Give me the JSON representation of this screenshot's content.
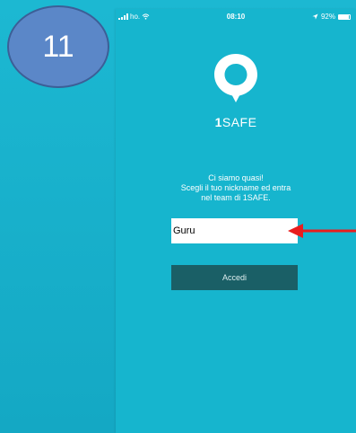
{
  "step_badge": {
    "number": "11"
  },
  "status_bar": {
    "carrier": "ho.",
    "time": "08:10",
    "battery": "92%"
  },
  "app": {
    "name_bold": "1",
    "name_rest": "SAFE"
  },
  "intro": {
    "line1": "Ci siamo quasi!",
    "line2": "Scegli il tuo nickname ed entra",
    "line3": "nel team di 1SAFE."
  },
  "nickname": {
    "value": "Guru"
  },
  "login_button": {
    "label": "Accedi"
  },
  "colors": {
    "background": "#16b5ce",
    "badge": "#5b87c8",
    "button": "#1a5f66",
    "arrow": "#e81e1e"
  },
  "icons": {
    "logo": "location-pin-icon",
    "arrow": "red-arrow-left-icon",
    "signal": "signal-bars-icon",
    "wifi": "wifi-icon",
    "location": "location-arrow-icon",
    "battery": "battery-icon"
  }
}
